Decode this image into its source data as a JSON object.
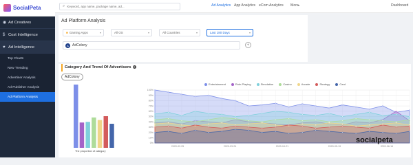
{
  "brand": {
    "logo_text": "SocialPeta",
    "watermark": "socialpeta"
  },
  "sidebar": {
    "groups": [
      {
        "label": "Ad Creatives",
        "icon": "eye-icon"
      },
      {
        "label": "Cost Intelligence",
        "icon": "dollar-icon"
      },
      {
        "label": "Ad Intelligence",
        "icon": "heart-icon"
      }
    ],
    "subitems": [
      {
        "label": "Top Charts"
      },
      {
        "label": "New Trending"
      },
      {
        "label": "Advertiser Analysis"
      },
      {
        "label": "Ad Publisher Analysis"
      },
      {
        "label": "Ad Platform Analysis"
      }
    ]
  },
  "topbar": {
    "search_placeholder": "Keyword, app name, package name, ad...",
    "nav": [
      "Ad Analytics",
      "App Analytics",
      "eCom Analytics",
      "More"
    ],
    "dashboard": "Dashboard"
  },
  "page": {
    "title": "Ad Platform Analysis"
  },
  "filters": {
    "category": "Gaming Apps",
    "os": "All OS",
    "country": "All Countries",
    "period": "Last 180 Days"
  },
  "platform": {
    "name": "AdColony"
  },
  "section": {
    "title": "Category And Trend Of Advertisers",
    "tag": "AdColony",
    "bar_caption": "The proportion of category"
  },
  "colors": {
    "accent": "#1e6fe0",
    "sidebar": "#1f2a3c"
  },
  "chart_data": [
    {
      "type": "bar",
      "title": "The proportion of category",
      "categories": [
        "Entertainment",
        "Role-Playing",
        "Simulation",
        "Casino",
        "Arcade",
        "Strategy",
        "Card"
      ],
      "values": [
        100,
        40,
        41,
        48,
        44,
        50,
        38
      ]
    },
    {
      "type": "area",
      "x": [
        "2020-02-25",
        "2020-03-24",
        "2020-04-21",
        "2020-05-19",
        "2020-06-16"
      ],
      "x_points": 20,
      "series": [
        {
          "name": "Entertainment",
          "color": "#7d8fe8",
          "values": [
            100,
            96,
            92,
            88,
            90,
            84,
            80,
            70,
            72,
            75,
            68,
            74,
            70,
            66,
            72,
            68,
            64,
            70,
            58,
            62
          ]
        },
        {
          "name": "Role-Playing",
          "color": "#a463c8",
          "values": [
            38,
            40,
            36,
            42,
            40,
            38,
            44,
            40,
            38,
            36,
            34,
            38,
            40,
            36,
            34,
            40,
            38,
            44,
            60,
            42
          ]
        },
        {
          "name": "Simulation",
          "color": "#7fd0dc",
          "values": [
            55,
            58,
            52,
            60,
            56,
            54,
            50,
            52,
            56,
            60,
            58,
            54,
            52,
            56,
            50,
            54,
            58,
            52,
            54,
            50
          ]
        },
        {
          "name": "Casino",
          "color": "#aedc9a",
          "values": [
            44,
            46,
            42,
            40,
            44,
            48,
            46,
            42,
            40,
            44,
            46,
            42,
            44,
            40,
            42,
            46,
            44,
            42,
            40,
            44
          ]
        },
        {
          "name": "Arcade",
          "color": "#f0d68a",
          "values": [
            36,
            38,
            34,
            32,
            36,
            38,
            34,
            36,
            38,
            34,
            32,
            36,
            34,
            38,
            36,
            32,
            34,
            36,
            38,
            34
          ]
        },
        {
          "name": "Strategy",
          "color": "#d35b5b",
          "values": [
            30,
            32,
            28,
            34,
            30,
            28,
            32,
            30,
            28,
            30,
            34,
            32,
            28,
            30,
            32,
            30,
            28,
            34,
            30,
            32
          ]
        },
        {
          "name": "Card",
          "color": "#4466aa",
          "values": [
            20,
            22,
            18,
            24,
            20,
            22,
            26,
            24,
            20,
            22,
            18,
            20,
            24,
            22,
            20,
            18,
            22,
            20,
            18,
            22
          ]
        }
      ],
      "ylim": [
        0,
        100
      ],
      "yticks": [
        "0%",
        "10%",
        "20%",
        "30%",
        "40%",
        "50%",
        "60%",
        "70%",
        "80%",
        "90%",
        "100%"
      ],
      "legend": "top-center",
      "grid": true
    }
  ]
}
